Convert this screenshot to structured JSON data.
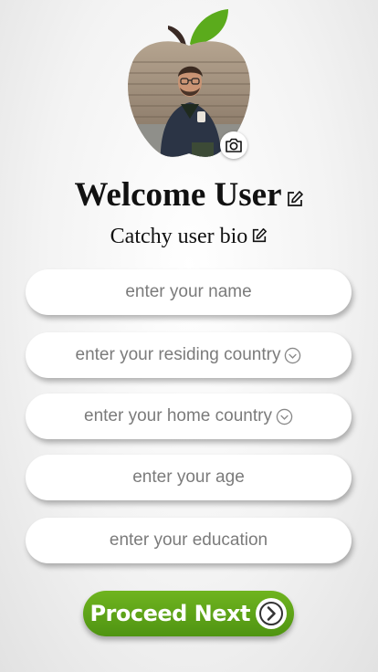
{
  "profile": {
    "avatar_icon": "apple-shaped-profile-photo",
    "camera_icon": "camera-icon"
  },
  "header": {
    "welcome": "Welcome User",
    "bio": "Catchy user bio"
  },
  "form": {
    "name_placeholder": "enter your name",
    "residing_country_placeholder": "enter your residing country",
    "home_country_placeholder": "enter your home country",
    "age_placeholder": "enter your age",
    "education_placeholder": "enter your education"
  },
  "actions": {
    "proceed_label": "Proceed Next"
  },
  "colors": {
    "accent_green": "#5ea51a",
    "leaf_green": "#5bab1c",
    "stem_dark": "#3a2a25"
  }
}
